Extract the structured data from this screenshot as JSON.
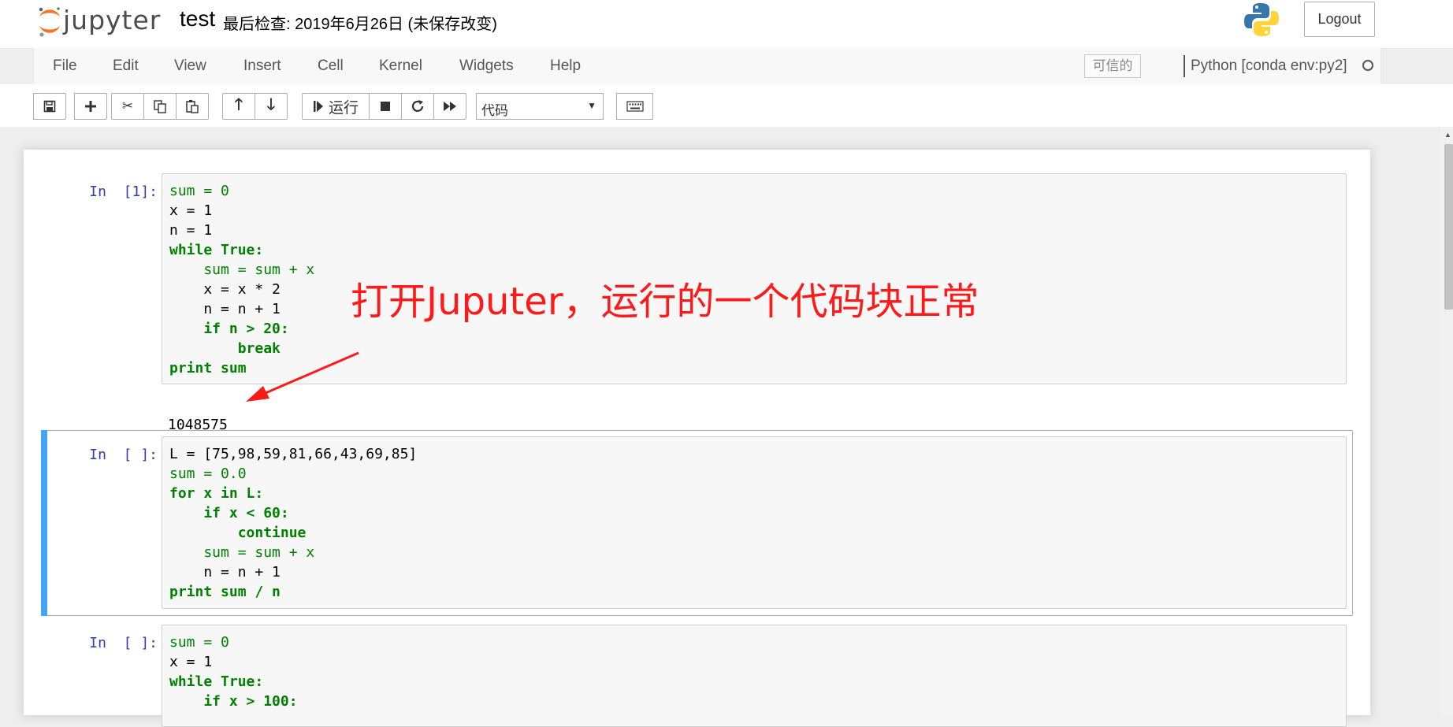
{
  "header": {
    "logo_text": "jupyter",
    "notebook_name": "test",
    "checkpoint": "最后检查: 2019年6月26日  (未保存改变)",
    "logout_label": "Logout"
  },
  "menubar": {
    "items": [
      "File",
      "Edit",
      "View",
      "Insert",
      "Cell",
      "Kernel",
      "Widgets",
      "Help"
    ],
    "trusted_label": "可信的",
    "kernel_name": "Python [conda env:py2]"
  },
  "toolbar": {
    "run_label": "运行",
    "cell_type": "代码"
  },
  "cells": [
    {
      "prompt": "In  [1]:",
      "lines": [
        "sum = 0",
        "x = 1",
        "n = 1",
        "while True:",
        "    sum = sum + x",
        "    x = x * 2",
        "    n = n + 1",
        "    if n > 20:",
        "        break",
        "print sum"
      ],
      "output": "1048575"
    },
    {
      "prompt": "In  [ ]:",
      "lines": [
        "L = [75,98,59,81,66,43,69,85]",
        "sum = 0.0",
        "for x in L:",
        "    if x < 60:",
        "        continue",
        "    sum = sum + x",
        "    n = n + 1",
        "print sum / n"
      ]
    },
    {
      "prompt": "In  [ ]:",
      "lines": [
        "sum = 0",
        "x = 1",
        "while True:",
        "    if x > 100:"
      ]
    }
  ],
  "annotation": {
    "text": "打开Juputer，运行的一个代码块正常",
    "color": "#ff1a1a"
  },
  "colors": {
    "keyword": "#008000",
    "operator": "#aa22ff",
    "prompt": "#303f9f",
    "selected_bar": "#42a5f5"
  }
}
